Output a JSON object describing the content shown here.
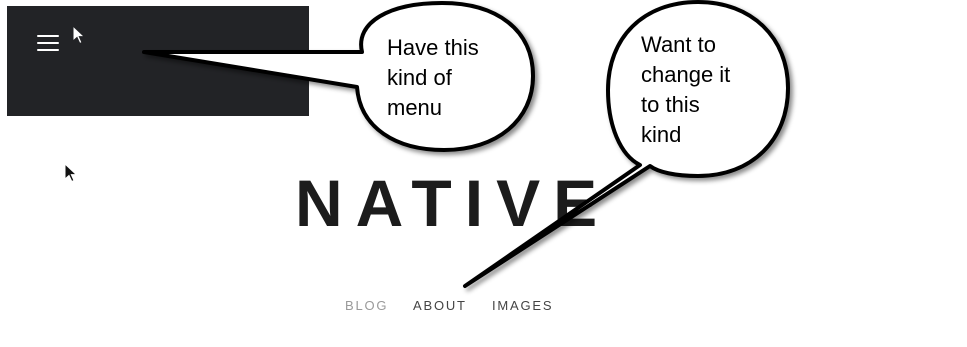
{
  "header": {
    "menu_icon": "hamburger-menu-icon",
    "background_color": "#222326",
    "pointer_icon": "mouse-cursor-white-icon"
  },
  "site": {
    "title": "NATIVE"
  },
  "nav": {
    "items": [
      {
        "label": "BLOG",
        "state": "active"
      },
      {
        "label": "ABOUT",
        "state": "normal"
      },
      {
        "label": "IMAGES",
        "state": "normal"
      }
    ]
  },
  "annotations": {
    "callout_left": {
      "lines": [
        "Have this",
        "kind of",
        "menu"
      ]
    },
    "callout_right": {
      "lines": [
        "Want to",
        "change it",
        "to this",
        "kind"
      ]
    }
  },
  "page_pointer_icon": "mouse-cursor-black-icon"
}
